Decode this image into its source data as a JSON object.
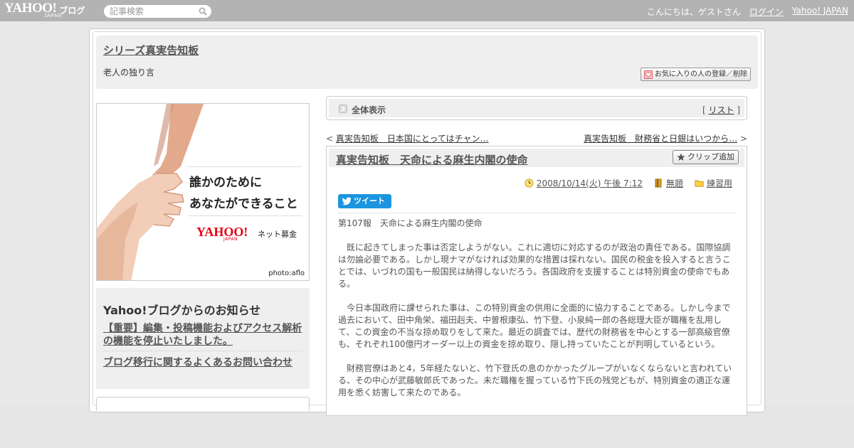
{
  "topbar": {
    "logo_main": "YAHOO!",
    "logo_sub": "JAPAN",
    "logo_blog": "ブログ",
    "search_placeholder": "記事検索",
    "greeting": "こんにちは、ゲストさん",
    "login": "ログイン",
    "yahoo_japan": "Yahoo! JAPAN"
  },
  "blog": {
    "title": "シリーズ真実告知板",
    "description": "老人の独り言",
    "fav_button": "お気に入りの人の登録／削除"
  },
  "banner": {
    "line1": "誰かのために",
    "line2": "あなたができること",
    "logo": "YAHOO!",
    "logo_sub": "JAPAN",
    "tagline": "ネット募金",
    "credit": "photo:aflo"
  },
  "notice": {
    "title": "Yahoo!ブログからのお知らせ",
    "link1": "【重要】編集・投稿機能およびアクセス解析の機能を停止いたしました。",
    "link2": "ブログ移行に関するよくあるお問い合わせ"
  },
  "viewbar": {
    "label": "全体表示",
    "list_open": "[ ",
    "list": "リスト",
    "list_close": " ]"
  },
  "nav": {
    "prev_arrow": "< ",
    "prev": "真実告知板　日本国にとってはチャン…",
    "next": "真実告知板　財務省と日銀はいつから…",
    "next_arrow": " >"
  },
  "article": {
    "title": "真実告知板　天命による麻生内閣の使命",
    "clip_button": "クリップ追加",
    "date": "2008/10/14(火) 午後 7:12",
    "theme": "無題",
    "category": "練習用",
    "tweet": "ツイート",
    "paragraphs": [
      "第107報　天命による麻生内閣の使命",
      "　既に起きてしまった事は否定しようがない。これに適切に対応するのが政治の責任である。国際協調は勿論必要である。しかし現ナマがなければ効果的な措置は採れない。国民の税金を投入すると言うことでは、いづれの国も一般国民は納得しないだろう。各国政府を支援することは特別資金の使命でもある。",
      "　今日本国政府に課せられた事は、この特別資金の供用に全面的に協力することである。しかし今まで過去において、田中角栄、福田赳夫、中曽根康弘、竹下登、小泉純一郎の各総理大臣が職権を乱用して、この資金の不当な掠め取りをして来た。最近の調査では、歴代の財務省を中心とする一部高級官僚も、それぞれ100億円オーダー以上の資金を掠め取り、隠し持っていたことが判明しているという。",
      "　財務官僚はあと4，5年経たないと、竹下登氏の息のかかったグループがいなくならないと言われている、その中心が武藤敏郎氏であった。未だ職権を握っている竹下氏の残党どもが、特別資金の適正な運用を悉く妨害して来たのである。"
    ]
  },
  "colors": {
    "topbar": "#b3b3b3",
    "tweet": "#1b95e0",
    "panel": "#efefef"
  }
}
